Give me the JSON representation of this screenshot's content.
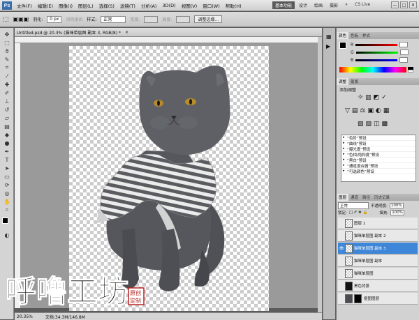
{
  "menubar": {
    "logo": "Ps",
    "items": [
      "文件(F)",
      "编辑(E)",
      "图像(I)",
      "图层(L)",
      "选择(S)",
      "滤镜(T)",
      "分析(A)",
      "3D(D)",
      "视图(V)",
      "窗口(W)",
      "帮助(H)"
    ],
    "zoom": "20.3"
  },
  "workspace": {
    "items": [
      "基本功能",
      "设计",
      "绘画",
      "摄影"
    ],
    "more": "»",
    "cslive": "CS Live"
  },
  "window": {
    "min": "—",
    "max": "□",
    "close": "✕"
  },
  "options": {
    "feather_label": "羽化:",
    "feather_value": "0 px",
    "antialias": "消除锯齿",
    "style_label": "样式:",
    "style_value": "正常",
    "width_label": "宽度:",
    "height_label": "高度:",
    "refine_button": "调整边缘..."
  },
  "document": {
    "tab": "Untitled.psd @ 20.3% (猫咪单层图 副本 3, RGB/8) *",
    "close": "×"
  },
  "status": {
    "zoom": "20.35%",
    "doc": "文档:34.3M/146.8M"
  },
  "panels": {
    "color_tabs": [
      "颜色",
      "色板",
      "样式"
    ],
    "color": {
      "r": "R",
      "g": "G",
      "b": "B",
      "fg": "#000000",
      "bg": "#ffffff"
    },
    "adjust_tabs": [
      "调整",
      "蒙版"
    ],
    "adjust_title": "添加调整",
    "presets": [
      "“色阶”预设",
      "“曲线”预设",
      "“曝光度”预设",
      "“色相/饱和度”预设",
      "“黑白”预设",
      "“通道混合器”预设",
      "“可选颜色”预设"
    ],
    "layers_tabs": [
      "图层",
      "通道",
      "路径",
      "历史记录"
    ],
    "blend_mode": "正常",
    "opacity_label": "不透明度:",
    "opacity_value": "100%",
    "lock_label": "锁定:",
    "fill_label": "填充:",
    "fill_value": "100%",
    "layers": [
      {
        "name": "图层 1",
        "visible": false,
        "thumb": "trans",
        "selected": false
      },
      {
        "name": "猫咪单层图 副本 2",
        "visible": false,
        "thumb": "trans",
        "selected": false
      },
      {
        "name": "猫咪单层图 副本 3",
        "visible": true,
        "thumb": "trans",
        "selected": true
      },
      {
        "name": "猫咪单层图 副本",
        "visible": false,
        "thumb": "trans",
        "selected": false
      },
      {
        "name": "猫咪单层图",
        "visible": false,
        "thumb": "trans",
        "selected": false
      },
      {
        "name": "黑色背景",
        "visible": false,
        "thumb": "dark",
        "selected": false
      },
      {
        "name": "抠图图层",
        "visible": false,
        "thumb": "photo",
        "selected": false
      }
    ]
  },
  "watermark": {
    "text": "呼噜工坊",
    "seal": "原创定制"
  }
}
